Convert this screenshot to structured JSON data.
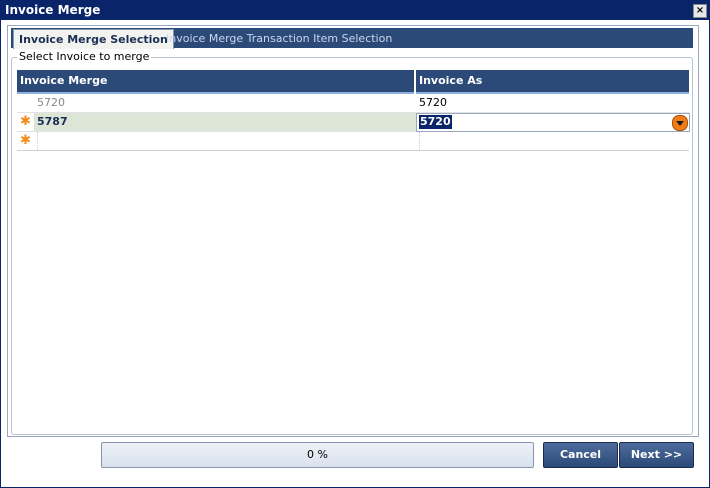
{
  "window": {
    "title": "Invoice Merge",
    "close_glyph": "×"
  },
  "tabs": [
    {
      "label": "Invoice Merge Selection",
      "active": true
    },
    {
      "label": "Invoice Merge Transaction Item Selection",
      "active": false
    }
  ],
  "group": {
    "label": "Select Invoice to merge"
  },
  "grid": {
    "columns": [
      "Invoice Merge",
      "Invoice As"
    ],
    "rows": [
      {
        "indicator": "",
        "invoice_merge": "5720",
        "invoice_as": "5720"
      },
      {
        "indicator": "edit-star",
        "invoice_merge": "5787",
        "invoice_as": "5720",
        "selected": true
      },
      {
        "indicator": "new-row-star",
        "invoice_merge": "",
        "invoice_as": ""
      }
    ],
    "indicator_glyph": "✱"
  },
  "progress": {
    "text": "0 %",
    "value": 0
  },
  "buttons": {
    "cancel": "Cancel",
    "next": "Next >>"
  },
  "colors": {
    "accent": "#2c4a78",
    "title_bar": "#0a246a",
    "dropdown": "#f07d18"
  }
}
